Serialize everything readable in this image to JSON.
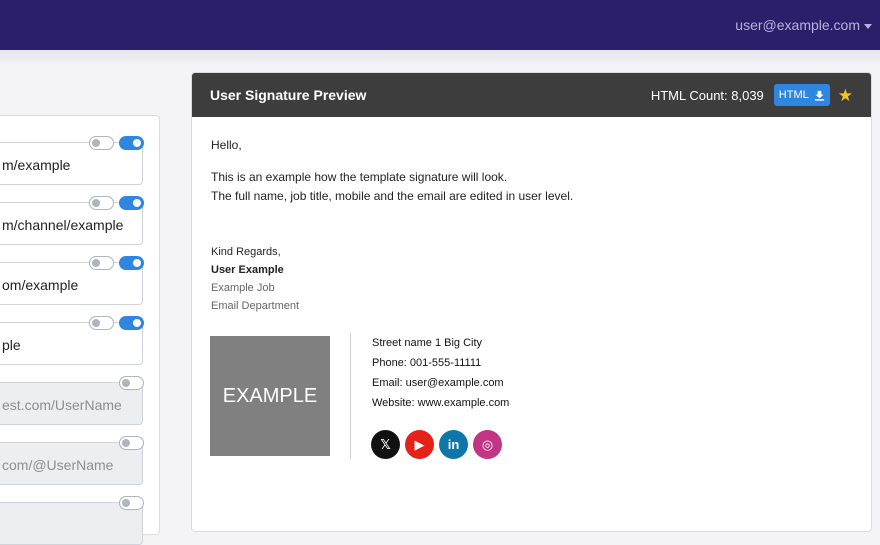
{
  "header": {
    "user_email": "user@example.com"
  },
  "left_panel": {
    "rows": [
      {
        "text": "m/example",
        "disabled": false,
        "toggles": [
          "off",
          "on"
        ]
      },
      {
        "text": "m/channel/example",
        "disabled": false,
        "toggles": [
          "off",
          "on"
        ]
      },
      {
        "text": "om/example",
        "disabled": false,
        "toggles": [
          "off",
          "on"
        ]
      },
      {
        "text": "ple",
        "disabled": false,
        "toggles": [
          "off",
          "on"
        ]
      },
      {
        "text": "est.com/UserName",
        "disabled": true,
        "toggles": [
          "off"
        ]
      },
      {
        "text": "com/@UserName",
        "disabled": true,
        "toggles": [
          "off"
        ]
      },
      {
        "text": "",
        "disabled": true,
        "toggles": [
          "off"
        ]
      }
    ]
  },
  "preview": {
    "title": "User Signature Preview",
    "html_count_label": "HTML Count: 8,039",
    "html_button_label": "HTML",
    "greeting": "Hello,",
    "intro_line1": "This is an example how the template signature will look.",
    "intro_line2": "The full name, job title, mobile and the email are edited in user level.",
    "regards": "Kind Regards,",
    "name": "User Example",
    "job": "Example Job",
    "department": "Email Department",
    "logo_text": "EXAMPLE",
    "address": "Street name 1 Big City",
    "phone": "Phone: 001-555-11111",
    "email": "Email: user@example.com",
    "website": "Website: www.example.com",
    "social_icons": [
      {
        "name": "x-icon",
        "color": "#111111",
        "glyph": "𝕏"
      },
      {
        "name": "youtube-icon",
        "color": "#e62117",
        "glyph": "▶"
      },
      {
        "name": "linkedin-icon",
        "color": "#0e76a8",
        "glyph": "in"
      },
      {
        "name": "instagram-icon",
        "color": "#c13584",
        "glyph": "◎"
      }
    ]
  }
}
